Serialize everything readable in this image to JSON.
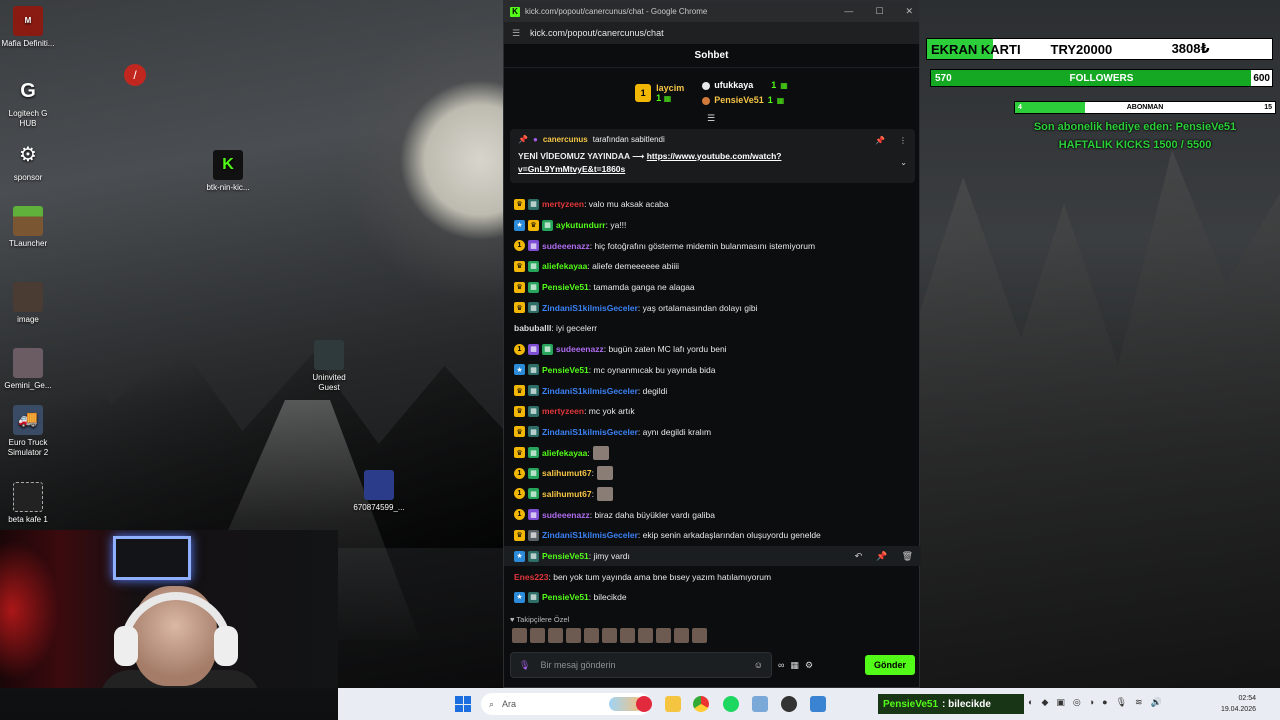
{
  "desktop": {
    "icons": [
      {
        "label": "Mafia Definiti...",
        "icon": "mafia-game-icon"
      },
      {
        "label": "Logitech G HUB",
        "icon": "logitech-g-icon"
      },
      {
        "label": "sponsor",
        "icon": "sponsor-icon"
      },
      {
        "label": "TLauncher",
        "icon": "minecraft-grass-block-icon"
      },
      {
        "label": "image",
        "icon": "image-file-icon"
      },
      {
        "label": "Gemini_Ge...",
        "icon": "image-file-icon"
      },
      {
        "label": "Euro Truck Simulator 2",
        "icon": "truck-icon"
      },
      {
        "label": "beta kafe 1",
        "icon": "film-file-icon"
      },
      {
        "label": "btk-nin-kic...",
        "icon": "kick-logo-icon"
      },
      {
        "label": "Uninvited Guest",
        "icon": "game-icon"
      },
      {
        "label": "670874599_...",
        "icon": "image-file-icon"
      }
    ]
  },
  "chrome": {
    "window_title": "kick.com/popout/canercunus/chat - Google Chrome",
    "url": "kick.com/popout/canercunus/chat",
    "favicon_letter": "K"
  },
  "chat": {
    "header": "Sohbet",
    "leaderboard": {
      "first": {
        "rank": "1",
        "name": "laycim",
        "count": "1"
      },
      "second": {
        "name": "ufukkaya",
        "count": "1"
      },
      "third": {
        "name": "PensieVe51",
        "count": "1"
      }
    },
    "pinned": {
      "pinned_by_user": "canercunus",
      "pinned_by_text": "tarafından sabitlendi",
      "text_prefix": "YENİ VİDEOMUZ YAYINDAA ⟶",
      "link": "https://www.youtube.com/watch?v=GnL9YmMtvyE&t=1860s"
    },
    "messages": [
      {
        "user": "mertyzeen",
        "color": "#e2363c",
        "text": ": valo mu aksak acaba",
        "badges": [
          "crown",
          "gift-teal"
        ]
      },
      {
        "user": "aykutundurr",
        "color": "#53fc18",
        "text": ": ya!!!",
        "badges": [
          "star",
          "crown",
          "gift-green"
        ]
      },
      {
        "user": "sudeeenazz",
        "color": "#b06cf0",
        "text": ": hiç fotoğrafını gösterme midemin bulanmasını istemiyorum",
        "badges": [
          "circle",
          "gift-purple"
        ]
      },
      {
        "user": "aliefekayaa",
        "color": "#53fc18",
        "text": ": aliefe demeeeeee abiiii",
        "badges": [
          "crown",
          "gift-green"
        ]
      },
      {
        "user": "PensieVe51",
        "color": "#53fc18",
        "text": ": tamamda ganga ne alagaa",
        "badges": [
          "crown",
          "gift-green"
        ]
      },
      {
        "user": "ZindaniS1kilmisGeceler",
        "color": "#3b82f6",
        "text": ": yaş ortalamasından dolayı gibi",
        "badges": [
          "crown",
          "gift-teal"
        ]
      },
      {
        "user": "babuballl",
        "color": "#dcdcdc",
        "text": ": iyi gecelerr",
        "badges": []
      },
      {
        "user": "sudeeenazz",
        "color": "#b06cf0",
        "text": ": bugün zaten MC lafı yordu beni",
        "badges": [
          "circle",
          "gift-purple",
          "gift-green"
        ]
      },
      {
        "user": "PensieVe51",
        "color": "#53fc18",
        "text": ": mc oynanmıcak bu yayında bida",
        "badges": [
          "star",
          "gift-teal"
        ]
      },
      {
        "user": "ZindaniS1kilmisGeceler",
        "color": "#3b82f6",
        "text": ": degildi",
        "badges": [
          "crown",
          "gift-teal"
        ]
      },
      {
        "user": "mertyzeen",
        "color": "#e2363c",
        "text": ": mc yok artık",
        "badges": [
          "crown",
          "gift-teal"
        ]
      },
      {
        "user": "ZindaniS1kilmisGeceler",
        "color": "#3b82f6",
        "text": ": aynı degildi kralım",
        "badges": [
          "crown",
          "gift-teal"
        ]
      },
      {
        "user": "aliefekayaa",
        "color": "#53fc18",
        "text": ":",
        "badges": [
          "crown",
          "gift-green"
        ],
        "emote": true
      },
      {
        "user": "salihumut67",
        "color": "#f6c546",
        "text": ":",
        "badges": [
          "circle",
          "gift-green"
        ],
        "emote": true
      },
      {
        "user": "salihumut67",
        "color": "#f6c546",
        "text": ":",
        "badges": [
          "circle",
          "gift-green"
        ],
        "emote": true
      },
      {
        "user": "sudeeenazz",
        "color": "#b06cf0",
        "text": ": biraz daha büyükler vardı galiba",
        "badges": [
          "circle",
          "gift-purple"
        ]
      },
      {
        "user": "ZindaniS1kilmisGeceler",
        "color": "#3b82f6",
        "text": ": ekip senin arkadaşlarından oluşuyordu genelde",
        "badges": [
          "crown",
          "grey"
        ]
      },
      {
        "user": "PensieVe51",
        "color": "#53fc18",
        "text": ": jimy vardı",
        "badges": [
          "star",
          "gift-teal"
        ],
        "hover": true
      },
      {
        "user": "Enes223",
        "color": "#e2363c",
        "text": ": ben yok tum yayında ama bne bısey yazım hatılamıyorum",
        "badges": []
      },
      {
        "user": "PensieVe51",
        "color": "#53fc18",
        "text": ": bilecikde",
        "badges": [
          "star",
          "gift-teal"
        ]
      }
    ],
    "followers_only_label": "Takipçilere Özel",
    "input_placeholder": "Bir mesaj gönderin",
    "send_label": "Gönder"
  },
  "overlays": {
    "goal_label": "EKRAN KARTI",
    "goal_current": "3808₺",
    "goal_target": "TRY20000",
    "goal_progress": 0.19,
    "followers_current": "570",
    "followers_label": "FOLLOWERS",
    "followers_target": "600",
    "followers_progress": 0.95,
    "sub_current": "4",
    "sub_label": "ABONMAN",
    "sub_target": "15",
    "sub_progress": 0.27,
    "last_gift_text": "Son abonelik hediye eden: PensieVe51",
    "weekly_kicks_text": "HAFTALIK KICKS 1500 / 5500",
    "accent_color": "#2ccf3a"
  },
  "taskbar": {
    "search_placeholder": "Ara",
    "overlay_user": "PensieVe51",
    "overlay_message": ": bilecikde",
    "time": "02:54",
    "date": "19.04.2026"
  }
}
